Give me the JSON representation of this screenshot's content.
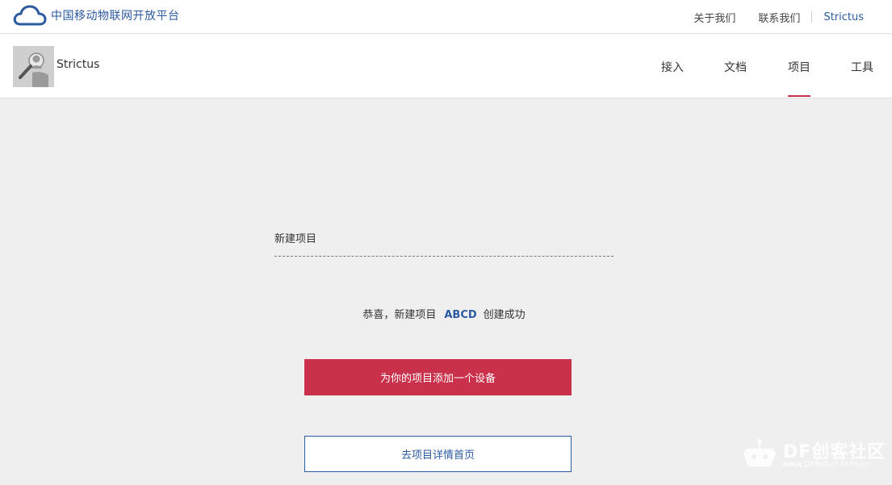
{
  "topbar": {
    "logo_text": "中国移动物联网开放平台",
    "links": {
      "about": "关于我们",
      "contact": "联系我们",
      "user": "Strictus"
    }
  },
  "navbar": {
    "username": "Strictus",
    "items": [
      {
        "label": "接入"
      },
      {
        "label": "文档"
      },
      {
        "label": "项目",
        "active": true
      },
      {
        "label": "工具"
      }
    ],
    "active_color": "#c9304a"
  },
  "main": {
    "section_title": "新建项目",
    "success_prefix": "恭喜，新建项目",
    "project_name": "ABCD",
    "success_suffix": "创建成功",
    "primary_button": "为你的项目添加一个设备",
    "secondary_button": "去项目详情首页"
  },
  "watermark": {
    "title": "DF创客社区",
    "url": "www.DFRobot.com.cn"
  },
  "colors": {
    "brand_blue": "#2c5aa0",
    "accent_red": "#c9304a",
    "background": "#efefef"
  }
}
